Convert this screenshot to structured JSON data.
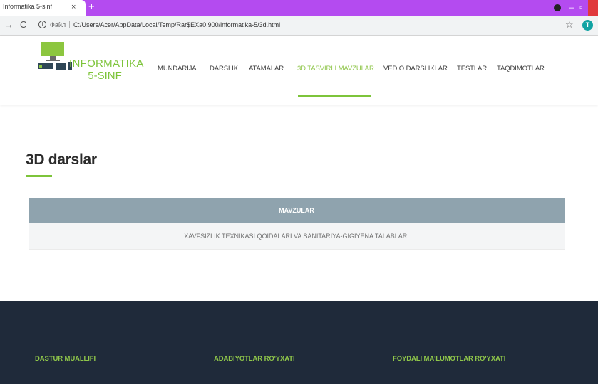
{
  "browser": {
    "tab_title": "Informatika 5-sinf",
    "tab_close": "×",
    "new_tab": "+",
    "url_label": "Файл",
    "url_separator": "|",
    "url": "C:/Users/Acer/AppData/Local/Temp/Rar$EXa0.900/informatika-5/3d.html",
    "avatar_letter": "T"
  },
  "site": {
    "brand_title": "INFORMATIKA",
    "brand_subtitle": "5-SINF",
    "nav": [
      {
        "label": "MUNDARIJA"
      },
      {
        "label": "DARSLIK"
      },
      {
        "label": "ATAMALAR"
      },
      {
        "label": "3D TASVIRLI MAVZULAR",
        "active": true
      },
      {
        "label": "VEDIO DARSLIKLAR"
      },
      {
        "label": "TESTLAR"
      },
      {
        "label": "TAQDIMOTLAR"
      }
    ]
  },
  "main": {
    "title": "3D darslar",
    "table": {
      "header": "MAVZULAR",
      "rows": [
        "XAVFSIZLIK TEXNIKASI QOIDALARI VA SANITARIYA-GIGIYENA TALABLARI"
      ]
    }
  },
  "footer": {
    "columns": [
      "DASTUR MUALLIFI",
      "ADABIYOTLAR RO'YXATI",
      "FOYDALI MA'LUMOTLAR RO'YXATI"
    ]
  },
  "colors": {
    "accent_green": "#7dc43a",
    "tab_strip": "#b44bf0",
    "table_header": "#8fa3ae",
    "footer_bg": "#1f2a3a"
  },
  "icons": [
    "back-icon",
    "reload-icon",
    "info-icon",
    "star-icon",
    "computer-logo-icon"
  ]
}
